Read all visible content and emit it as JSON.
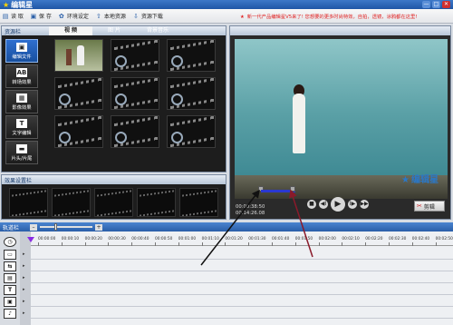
{
  "window": {
    "app_name": "编辑星",
    "minimize": "—",
    "maximize": "□",
    "close": "✕"
  },
  "toolbar": {
    "items": [
      {
        "label": "读 取",
        "icon": "open-icon"
      },
      {
        "label": "保 存",
        "icon": "save-icon"
      },
      {
        "label": "环境设定",
        "icon": "gear-icon"
      },
      {
        "label": "本地资源",
        "icon": "local-resource-icon"
      },
      {
        "label": "资源下载",
        "icon": "download-icon"
      }
    ],
    "notice": "新一代产品编辑星V5来了! 您想要的更多时尚特效，自拍，透镜，涂鸦都在这里!"
  },
  "resource_panel": {
    "title": "资源栏",
    "tabs": [
      "视 频",
      "图  片",
      "背景音乐"
    ],
    "active_tab": 0,
    "side_buttons": [
      {
        "label": "编辑文件",
        "icon": "film-icon",
        "glyph": "▣"
      },
      {
        "label": "转场效果",
        "icon": "transition-icon",
        "glyph": "AB"
      },
      {
        "label": "影像效果",
        "icon": "image-effect-icon",
        "glyph": "▦"
      },
      {
        "label": "文字编辑",
        "icon": "text-icon",
        "glyph": "T"
      },
      {
        "label": "片头/片尾",
        "icon": "intro-outro-icon",
        "glyph": "▬"
      }
    ]
  },
  "effects_panel": {
    "title": "效果设置栏"
  },
  "preview": {
    "watermark": "编辑星",
    "time_current": "00:00:38:50",
    "time_total": "00:14:26.08",
    "controls": [
      "■",
      "◀I",
      "▶",
      "I▶",
      "▶▶"
    ],
    "cut_label": "剪辑"
  },
  "timeline": {
    "title": "轨道栏",
    "zoom_minus": "–",
    "zoom_plus": "+",
    "ticks": [
      "00:00:00",
      "00:00:10",
      "00:00:20",
      "00:00:30",
      "00:00:40",
      "00:00:50",
      "00:01:00",
      "00:01:10",
      "00:01:20",
      "00:01:30",
      "00:01:40",
      "00:01:50",
      "00:02:00",
      "00:02:10",
      "00:02:20",
      "00:02:30",
      "00:02:40",
      "00:02:50"
    ],
    "tools": [
      {
        "icon": "clock-icon",
        "glyph": "◷"
      },
      {
        "icon": "video-track-icon",
        "glyph": "▭"
      },
      {
        "icon": "transition-track-icon",
        "glyph": "⇆"
      },
      {
        "icon": "effect-track-icon",
        "glyph": "▤"
      },
      {
        "icon": "text-track-icon",
        "glyph": "T"
      },
      {
        "icon": "overlay-track-icon",
        "glyph": "▣"
      },
      {
        "icon": "music-track-icon",
        "glyph": "♪"
      }
    ]
  },
  "colors": {
    "accent": "#2a5fa8",
    "notice": "#e02020",
    "arrow_black": "#111111",
    "arrow_red": "#8a1a2a",
    "seek_range": "#2a38d0"
  }
}
